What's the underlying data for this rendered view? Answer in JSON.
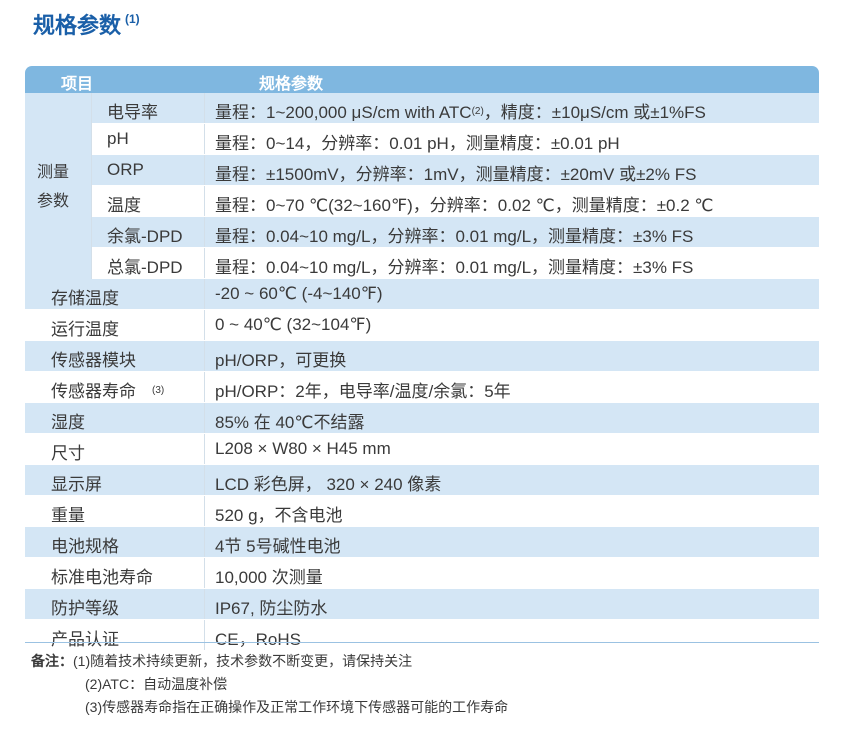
{
  "title": "规格参数",
  "title_note": "(1)",
  "header": {
    "col1": "项目",
    "col2": "规格参数"
  },
  "measure_group": {
    "label_line1": "测量",
    "label_line2": "参数"
  },
  "measure_rows": [
    {
      "key": "电导率",
      "value": "量程：1~200,000 μS/cm with ATC",
      "sup": "(2)",
      "value_tail": "，精度：±10μS/cm 或±1%FS"
    },
    {
      "key": "pH",
      "value": "量程：0~14，分辨率：0.01 pH，测量精度：±0.01 pH"
    },
    {
      "key": "ORP",
      "value": "量程：±1500mV，分辨率：1mV，测量精度：±20mV 或±2% FS"
    },
    {
      "key": "温度",
      "value": "量程：0~70 ℃(32~160℉)，分辨率：0.02 ℃，测量精度：±0.2 ℃"
    },
    {
      "key": "余氯-DPD",
      "value": "量程：0.04~10 mg/L，分辨率：0.01 mg/L，测量精度：±3% FS"
    },
    {
      "key": "总氯-DPD",
      "value": "量程：0.04~10 mg/L，分辨率：0.01 mg/L，测量精度：±3% FS"
    }
  ],
  "rows": [
    {
      "key": "存储温度",
      "value": "-20 ~ 60℃ (-4~140℉)"
    },
    {
      "key": "运行温度",
      "value": "0 ~ 40℃ (32~104℉)"
    },
    {
      "key": "传感器模块",
      "value": "pH/ORP，可更换"
    },
    {
      "key": "传感器寿命",
      "sup": "(3)",
      "value": "pH/ORP：2年，电导率/温度/余氯：5年"
    },
    {
      "key": "湿度",
      "value": "85% 在 40℃不结露"
    },
    {
      "key": "尺寸",
      "value": "L208 × W80 × H45 mm"
    },
    {
      "key": "显示屏",
      "value": "LCD 彩色屏， 320 × 240 像素"
    },
    {
      "key": "重量",
      "value": "520 g，不含电池"
    },
    {
      "key": "电池规格",
      "value": "4节 5号碱性电池"
    },
    {
      "key": "标准电池寿命",
      "value": "10,000 次测量"
    },
    {
      "key": "防护等级",
      "value": "IP67, 防尘防水"
    },
    {
      "key": "产品认证",
      "value": "CE，RoHS"
    }
  ],
  "notes": {
    "label": "备注：",
    "line1": "(1)随着技术持续更新，技术参数不断变更，请保持关注",
    "line2": "(2)ATC：自动温度补偿",
    "line3": "(3)传感器寿命指在正确操作及正常工作环境下传感器可能的工作寿命"
  },
  "colors": {
    "title": "#1a5fa8",
    "header_bg": "#7fb7e0",
    "row_alt": "#d4e6f5"
  }
}
